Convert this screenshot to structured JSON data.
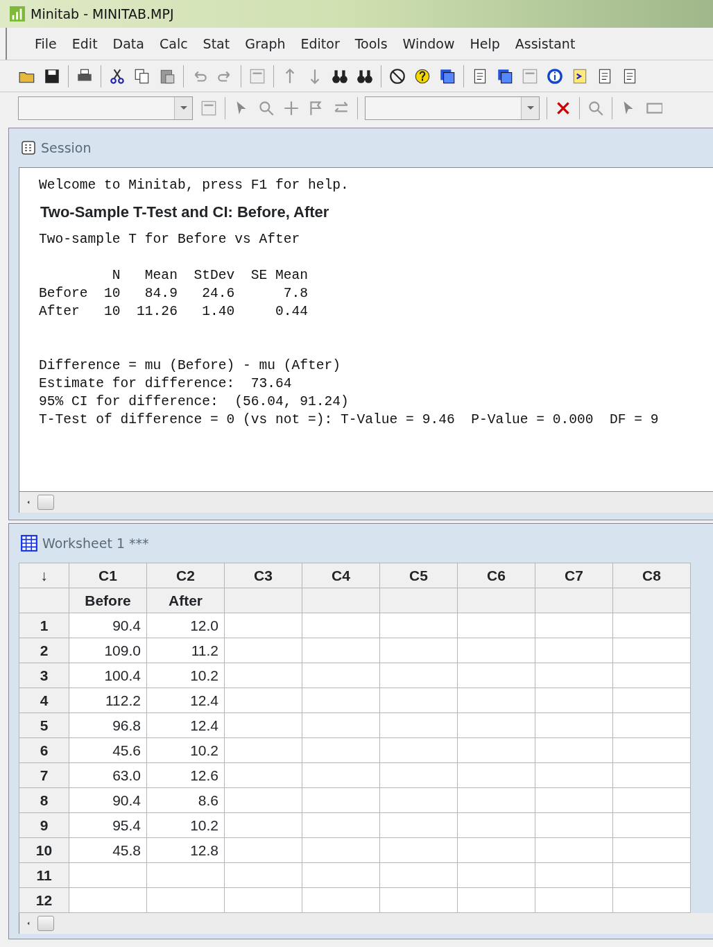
{
  "window": {
    "title": "Minitab - MINITAB.MPJ"
  },
  "menu": [
    "File",
    "Edit",
    "Data",
    "Calc",
    "Stat",
    "Graph",
    "Editor",
    "Tools",
    "Window",
    "Help",
    "Assistant"
  ],
  "session": {
    "title": "Session",
    "blocks": [
      {
        "kind": "mono",
        "text": "Welcome to Minitab, press F1 for help."
      },
      {
        "kind": "heading",
        "text": "Two-Sample T-Test and CI: Before, After"
      },
      {
        "kind": "mono",
        "text": "Two-sample T for Before vs After"
      },
      {
        "kind": "gap"
      },
      {
        "kind": "mono",
        "text": "         N   Mean  StDev  SE Mean"
      },
      {
        "kind": "mono",
        "text": "Before  10   84.9   24.6      7.8"
      },
      {
        "kind": "mono",
        "text": "After   10  11.26   1.40     0.44"
      },
      {
        "kind": "gap"
      },
      {
        "kind": "gap"
      },
      {
        "kind": "mono",
        "text": "Difference = mu (Before) - mu (After)"
      },
      {
        "kind": "mono",
        "text": "Estimate for difference:  73.64"
      },
      {
        "kind": "mono",
        "text": "95% CI for difference:  (56.04, 91.24)"
      },
      {
        "kind": "mono",
        "text": "T-Test of difference = 0 (vs not =): T-Value = 9.46  P-Value = 0.000  DF = 9"
      }
    ]
  },
  "worksheet": {
    "title": "Worksheet 1 ***",
    "corner": "↓",
    "columns": [
      {
        "id": "C1",
        "name": "Before"
      },
      {
        "id": "C2",
        "name": "After"
      },
      {
        "id": "C3"
      },
      {
        "id": "C4"
      },
      {
        "id": "C5"
      },
      {
        "id": "C6"
      },
      {
        "id": "C7"
      },
      {
        "id": "C8"
      }
    ],
    "rows": [
      {
        "n": "1",
        "cells": [
          "90.4",
          "12.0"
        ]
      },
      {
        "n": "2",
        "cells": [
          "109.0",
          "11.2"
        ]
      },
      {
        "n": "3",
        "cells": [
          "100.4",
          "10.2"
        ]
      },
      {
        "n": "4",
        "cells": [
          "112.2",
          "12.4"
        ]
      },
      {
        "n": "5",
        "cells": [
          "96.8",
          "12.4"
        ]
      },
      {
        "n": "6",
        "cells": [
          "45.6",
          "10.2"
        ]
      },
      {
        "n": "7",
        "cells": [
          "63.0",
          "12.6"
        ]
      },
      {
        "n": "8",
        "cells": [
          "90.4",
          "8.6"
        ]
      },
      {
        "n": "9",
        "cells": [
          "95.4",
          "10.2"
        ]
      },
      {
        "n": "10",
        "cells": [
          "45.8",
          "12.8"
        ]
      },
      {
        "n": "11",
        "cells": []
      },
      {
        "n": "12",
        "cells": []
      }
    ]
  }
}
